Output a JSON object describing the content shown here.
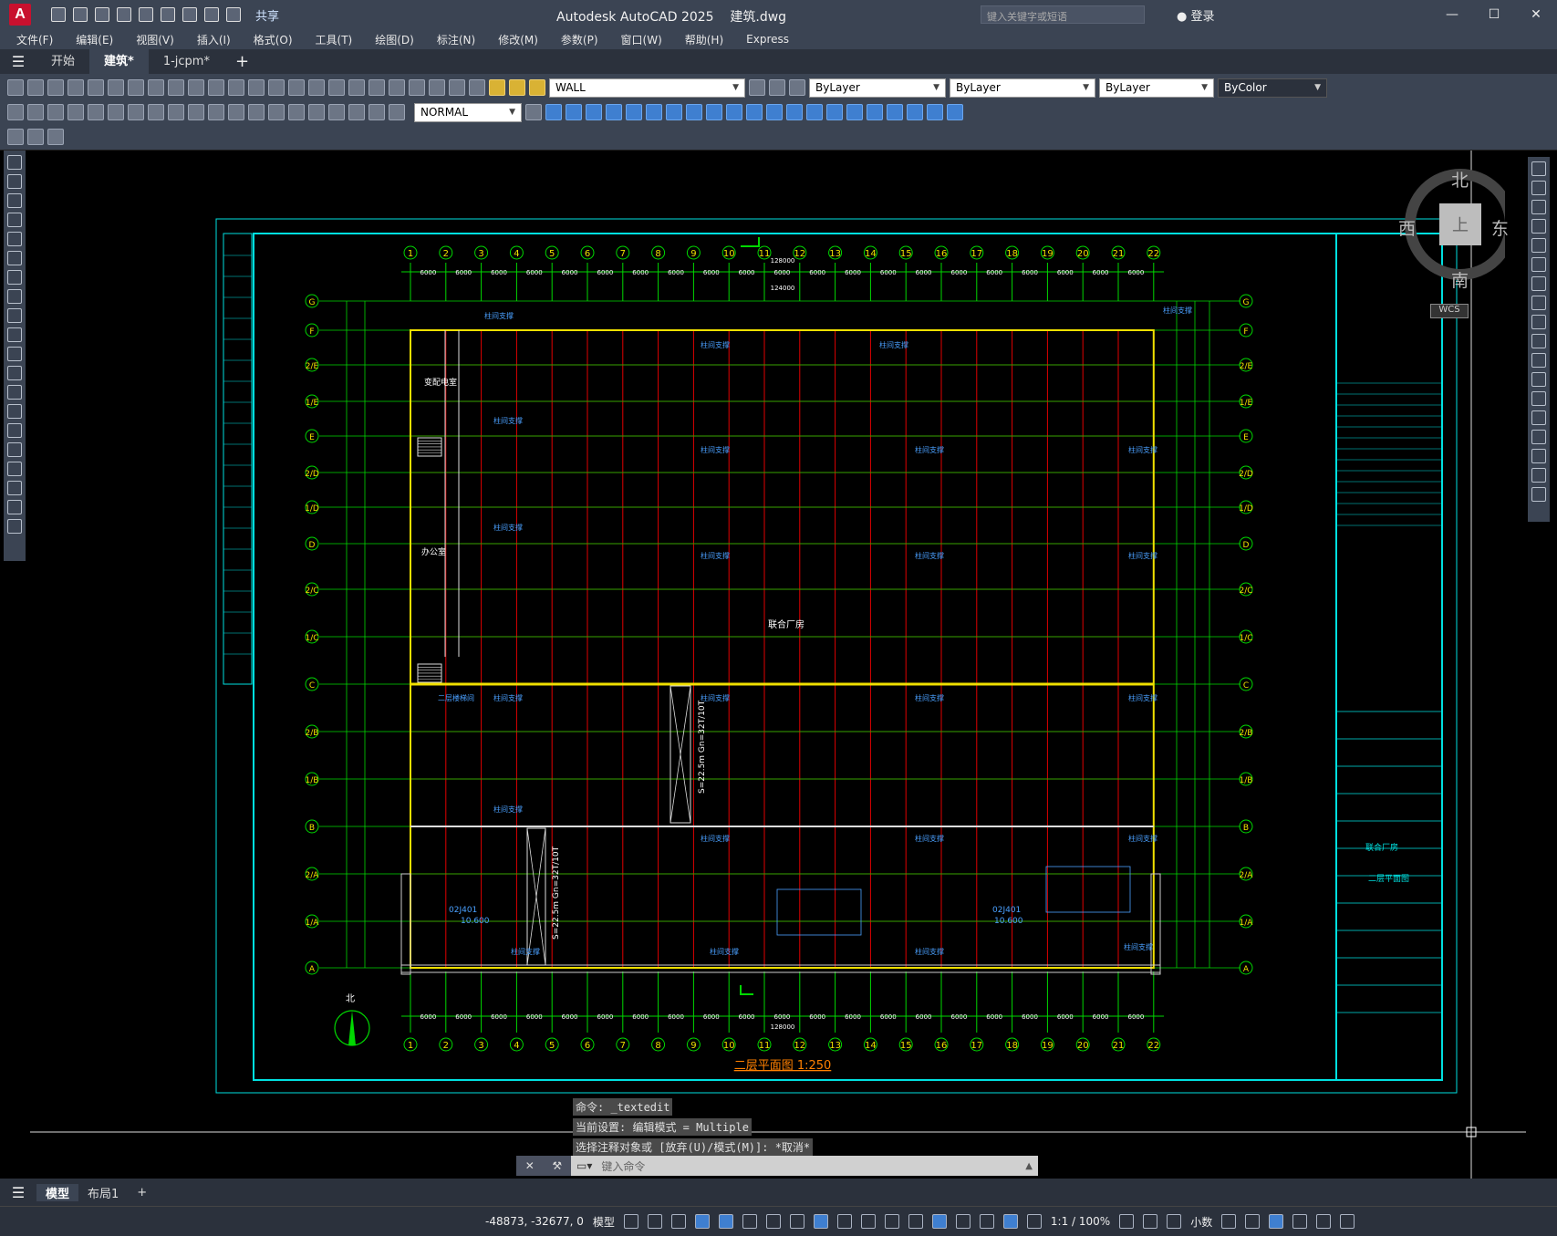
{
  "titlebar": {
    "logo": "A",
    "share_label": "共享",
    "app_title": "Autodesk AutoCAD 2025",
    "file_name": "建筑.dwg",
    "search_placeholder": "键入关键字或短语",
    "login_label": "登录",
    "minimize": "—",
    "maximize": "☐",
    "close": "✕"
  },
  "menubar": {
    "items": [
      "文件(F)",
      "编辑(E)",
      "视图(V)",
      "插入(I)",
      "格式(O)",
      "工具(T)",
      "绘图(D)",
      "标注(N)",
      "修改(M)",
      "参数(P)",
      "窗口(W)",
      "帮助(H)",
      "Express"
    ]
  },
  "tabs": {
    "items": [
      {
        "label": "开始",
        "active": false
      },
      {
        "label": "建筑*",
        "active": true
      },
      {
        "label": "1-jcpm*",
        "active": false
      }
    ],
    "add_label": "+"
  },
  "toolbar": {
    "layer_name": "WALL",
    "color": "ByLayer",
    "linetype": "ByLayer",
    "lineweight": "ByLayer",
    "plotstyle": "ByColor",
    "dimstyle": "NORMAL"
  },
  "viewcube": {
    "north": "北",
    "south": "南",
    "east": "东",
    "west": "西",
    "top": "上",
    "wcs": "WCS"
  },
  "drawing": {
    "title": "二层平面图  1:250",
    "main_label": "联合厂房",
    "room_1": "变配电室",
    "room_2": "办公室",
    "total_dim": "128000",
    "inner_dim": "124000",
    "bay_dim": "6000",
    "north_label": "北",
    "cols": [
      "1",
      "2",
      "3",
      "4",
      "5",
      "6",
      "7",
      "8",
      "9",
      "10",
      "11",
      "12",
      "13",
      "14",
      "15",
      "16",
      "17",
      "18",
      "19",
      "20",
      "21",
      "22"
    ],
    "rows": [
      "G",
      "F",
      "2/E",
      "1/E",
      "E",
      "2/D",
      "1/D",
      "D",
      "2/C",
      "1/C",
      "C",
      "2/B",
      "1/B",
      "B",
      "2/A",
      "1/A",
      "A"
    ],
    "brace_label": "柱间支撑",
    "ramp_label": "S=22.5m  Gn=32T/10T",
    "ref_label": "02J401",
    "elev_label": "10.600",
    "stair_label": "二层楼梯间"
  },
  "colors": {
    "grid_red": "#e00000",
    "grid_green": "#00d800",
    "frame_cyan": "#00e0e0",
    "wall_yellow": "#f0e000",
    "label_blue": "#4aa0ff",
    "title_orange": "#ff8000"
  },
  "command": {
    "history": [
      "命令: _textedit",
      "当前设置: 编辑模式 = Multiple",
      "选择注释对象或 [放弃(U)/模式(M)]: *取消*"
    ],
    "placeholder": "键入命令"
  },
  "layout_tabs": {
    "items": [
      "模型",
      "布局1"
    ],
    "add_label": "+"
  },
  "status": {
    "coords": "-48873, -32677, 0",
    "model": "模型",
    "scale": "1:1 / 100%",
    "units": "小数"
  }
}
